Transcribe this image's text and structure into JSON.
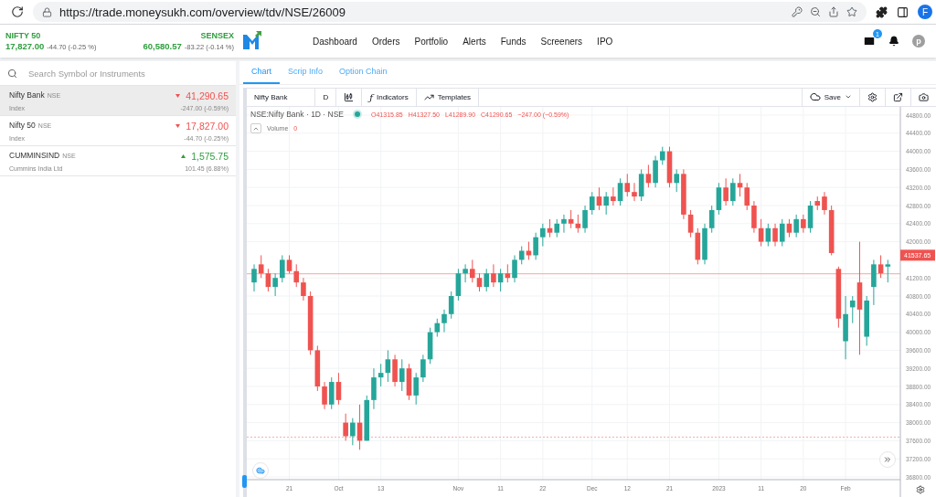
{
  "browser": {
    "url": "https://trade.moneysukh.com/overview/tdv/NSE/26009",
    "profile": "F"
  },
  "tickers": [
    {
      "name": "NIFTY 50",
      "value": "17,827.00",
      "change": "-44.70 (-0.25 %)"
    },
    {
      "name": "SENSEX",
      "value": "60,580.57",
      "change": "-83.22 (-0.14 %)"
    }
  ],
  "nav": [
    "Dashboard",
    "Orders",
    "Portfolio",
    "Alerts",
    "Funds",
    "Screeners",
    "IPO"
  ],
  "mail_badge": "1",
  "avatar": "p",
  "search": {
    "placeholder": "Search Symbol or Instruments"
  },
  "watchlist": [
    {
      "name": "Nifty Bank",
      "exchange": "NSE",
      "sub": "Index",
      "price": "41,290.65",
      "change": "-247.00 (-0.59%)",
      "kind": "down",
      "selected": true
    },
    {
      "name": "Nifty 50",
      "exchange": "NSE",
      "sub": "Index",
      "price": "17,827.00",
      "change": "-44.70 (-0.25%)",
      "kind": "down",
      "selected": false
    },
    {
      "name": "CUMMINSIND",
      "exchange": "NSE",
      "sub": "Cummins India Ltd",
      "price": "1,575.75",
      "change": "101.45 (6.88%)",
      "kind": "up",
      "selected": false
    }
  ],
  "tabs": [
    {
      "label": "Chart",
      "selected": true
    },
    {
      "label": "Scrip Info",
      "selected": false
    },
    {
      "label": "Option Chain",
      "selected": false
    }
  ],
  "toolbar": {
    "symbol": "Nifty Bank",
    "interval": "D",
    "indicators_glyph": "ƒ",
    "indicators": "Indicators",
    "templates": "Templates",
    "save": "Save"
  },
  "legend": {
    "title": "NSE:Nifty Bank · 1D · NSE",
    "open": "O41315.85",
    "high": "H41327.50",
    "low": "L41289.90",
    "close": "C41290.65",
    "change": "−247.00 (−0.59%)",
    "volume_label": "Volume",
    "volume_value": "0"
  },
  "price_label": "41537.65",
  "chart_data": {
    "type": "candlestick",
    "ylim": [
      36800,
      44800
    ],
    "yticks": [
      {
        "value": 36800,
        "label": "36800.00"
      },
      {
        "value": 37200,
        "label": "37200.00"
      },
      {
        "value": 37600,
        "label": "37600.00"
      },
      {
        "value": 38000,
        "label": "38000.00"
      },
      {
        "value": 38400,
        "label": "38400.00"
      },
      {
        "value": 38800,
        "label": "38800.00"
      },
      {
        "value": 39200,
        "label": "39200.00"
      },
      {
        "value": 39600,
        "label": "39600.00"
      },
      {
        "value": 40000,
        "label": "40000.00"
      },
      {
        "value": 40400,
        "label": "40400.00"
      },
      {
        "value": 40800,
        "label": "40800.00"
      },
      {
        "value": 41200,
        "label": "41200.00"
      },
      {
        "value": 42000,
        "label": "42000.00"
      },
      {
        "value": 42400,
        "label": "42400.00"
      },
      {
        "value": 42800,
        "label": "42800.00"
      },
      {
        "value": 43200,
        "label": "43200.00"
      },
      {
        "value": 43600,
        "label": "43600.00"
      },
      {
        "value": 44000,
        "label": "44000.00"
      },
      {
        "value": 44400,
        "label": "44400.00"
      },
      {
        "value": 44800,
        "label": "44800.00"
      }
    ],
    "grid": true,
    "ref_lines": [
      {
        "axis": "y",
        "value": 41290.65
      },
      {
        "axis": "y",
        "value": 37680
      }
    ],
    "categories": [
      null,
      null,
      null,
      null,
      null,
      "21",
      null,
      null,
      null,
      null,
      null,
      null,
      "Oct",
      null,
      null,
      null,
      null,
      null,
      "13",
      null,
      null,
      null,
      null,
      null,
      null,
      null,
      null,
      null,
      null,
      "Nov",
      null,
      null,
      null,
      null,
      null,
      "11",
      null,
      null,
      null,
      null,
      null,
      "22",
      null,
      null,
      null,
      null,
      null,
      null,
      "Dec",
      null,
      null,
      null,
      null,
      "12",
      null,
      null,
      null,
      null,
      null,
      "21",
      null,
      null,
      null,
      null,
      null,
      null,
      "2023",
      null,
      null,
      null,
      null,
      null,
      "11",
      null,
      null,
      null,
      null,
      null,
      "20",
      null,
      null,
      null,
      null,
      null,
      "Feb",
      null,
      null,
      null,
      null,
      null,
      null
    ],
    "ohlc": [
      [
        41100,
        41500,
        40900,
        41400
      ],
      [
        41500,
        41700,
        41200,
        41300
      ],
      [
        41300,
        41400,
        40900,
        41000
      ],
      [
        41000,
        41300,
        40800,
        41200
      ],
      [
        41200,
        41700,
        41100,
        41600
      ],
      [
        41600,
        41700,
        41300,
        41350
      ],
      [
        41350,
        41500,
        41000,
        41100
      ],
      [
        41100,
        41200,
        40700,
        40800
      ],
      [
        40800,
        40900,
        39500,
        39600
      ],
      [
        39600,
        39700,
        38700,
        38800
      ],
      [
        38800,
        38900,
        38300,
        38400
      ],
      [
        38400,
        39000,
        38300,
        38900
      ],
      [
        38900,
        39100,
        38400,
        38500
      ],
      [
        38000,
        38200,
        37600,
        37700
      ],
      [
        37700,
        38100,
        37500,
        38000
      ],
      [
        38000,
        38400,
        37400,
        37600
      ],
      [
        37600,
        38600,
        37600,
        38500
      ],
      [
        38500,
        39200,
        38300,
        39000
      ],
      [
        39000,
        39300,
        38800,
        39100
      ],
      [
        39100,
        39600,
        38900,
        39400
      ],
      [
        39400,
        39500,
        38800,
        38900
      ],
      [
        38900,
        39400,
        38700,
        39200
      ],
      [
        39200,
        39300,
        38500,
        38600
      ],
      [
        38600,
        39100,
        38400,
        39000
      ],
      [
        39000,
        39500,
        38900,
        39400
      ],
      [
        39400,
        40100,
        39300,
        40000
      ],
      [
        40000,
        40300,
        39900,
        40200
      ],
      [
        40200,
        40500,
        40000,
        40400
      ],
      [
        40400,
        40900,
        40300,
        40800
      ],
      [
        40800,
        41400,
        40700,
        41300
      ],
      [
        41300,
        41500,
        41100,
        41400
      ],
      [
        41400,
        41600,
        41100,
        41200
      ],
      [
        41200,
        41300,
        40900,
        41000
      ],
      [
        41000,
        41400,
        40900,
        41300
      ],
      [
        41300,
        41500,
        41000,
        41100
      ],
      [
        41100,
        41400,
        40900,
        41300
      ],
      [
        41300,
        41500,
        41100,
        41200
      ],
      [
        41200,
        41700,
        41100,
        41600
      ],
      [
        41600,
        41900,
        41500,
        41800
      ],
      [
        41800,
        42000,
        41600,
        41700
      ],
      [
        41700,
        42200,
        41600,
        42100
      ],
      [
        42100,
        42400,
        41900,
        42300
      ],
      [
        42300,
        42500,
        42100,
        42200
      ],
      [
        42200,
        42500,
        42100,
        42400
      ],
      [
        42400,
        42600,
        42200,
        42500
      ],
      [
        42500,
        42700,
        42300,
        42400
      ],
      [
        42400,
        42600,
        42200,
        42300
      ],
      [
        42300,
        42800,
        42200,
        42700
      ],
      [
        42700,
        43100,
        42600,
        43000
      ],
      [
        43000,
        43200,
        42700,
        42800
      ],
      [
        42800,
        43100,
        42600,
        43000
      ],
      [
        43000,
        43200,
        42800,
        42900
      ],
      [
        42900,
        43400,
        42800,
        43300
      ],
      [
        43300,
        43500,
        43000,
        43100
      ],
      [
        43100,
        43300,
        42900,
        43000
      ],
      [
        43000,
        43600,
        42900,
        43500
      ],
      [
        43500,
        43700,
        43200,
        43300
      ],
      [
        43300,
        43900,
        43200,
        43800
      ],
      [
        43800,
        44100,
        43700,
        44000
      ],
      [
        44000,
        44100,
        43200,
        43300
      ],
      [
        43300,
        43600,
        43100,
        43500
      ],
      [
        43500,
        43600,
        42500,
        42600
      ],
      [
        42600,
        42700,
        42100,
        42200
      ],
      [
        42200,
        42300,
        41500,
        41600
      ],
      [
        41600,
        42400,
        41500,
        42300
      ],
      [
        42300,
        42800,
        42200,
        42700
      ],
      [
        42700,
        43300,
        42600,
        43200
      ],
      [
        43200,
        43400,
        42800,
        42900
      ],
      [
        42900,
        43400,
        42800,
        43300
      ],
      [
        43300,
        43500,
        43000,
        43200
      ],
      [
        43200,
        43300,
        42700,
        42800
      ],
      [
        42800,
        42900,
        42200,
        42300
      ],
      [
        42300,
        42500,
        41900,
        42000
      ],
      [
        42000,
        42400,
        41900,
        42300
      ],
      [
        42300,
        42400,
        41900,
        42000
      ],
      [
        42000,
        42500,
        41900,
        42400
      ],
      [
        42400,
        42500,
        42100,
        42200
      ],
      [
        42200,
        42600,
        42100,
        42500
      ],
      [
        42500,
        42600,
        42200,
        42300
      ],
      [
        42300,
        42900,
        42200,
        42800
      ],
      [
        42900,
        43000,
        42700,
        42800
      ],
      [
        43000,
        43100,
        42600,
        42700
      ],
      [
        42700,
        42800,
        41700,
        41750
      ],
      [
        41400,
        41450,
        40100,
        40300
      ],
      [
        39800,
        40800,
        39400,
        40400
      ],
      [
        40550,
        40800,
        40200,
        40700
      ],
      [
        41100,
        42000,
        39500,
        40500
      ],
      [
        39900,
        40800,
        39700,
        40700
      ],
      [
        41000,
        41600,
        40600,
        41500
      ],
      [
        41500,
        41700,
        41200,
        41300
      ],
      [
        41450,
        41600,
        41100,
        41500
      ]
    ]
  }
}
